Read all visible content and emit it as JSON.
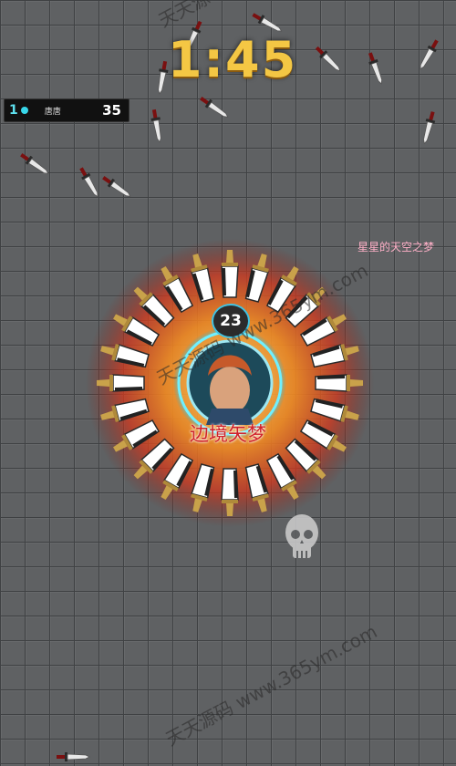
{
  "timer": "1:45",
  "leaderboard": {
    "rank": "1",
    "name": "唐唐",
    "score": "35"
  },
  "player": {
    "name": "边境矢梦",
    "level": "23"
  },
  "enemy": {
    "name": "星星的天空之梦"
  },
  "watermark": {
    "text": "天天源码 www.365ym.com",
    "text_top": "天天源"
  },
  "icons": {
    "skull": "skull-icon",
    "knife": "knife-pickup-icon",
    "blade": "orbiting-blade-icon",
    "avatar": "hero-portrait-icon"
  },
  "colors": {
    "timer": "#f4c744",
    "ring": "#3fd8f0",
    "aura": "#f07a1c",
    "player_name": "#d0222a",
    "enemy_name": "#ffb0c8"
  }
}
